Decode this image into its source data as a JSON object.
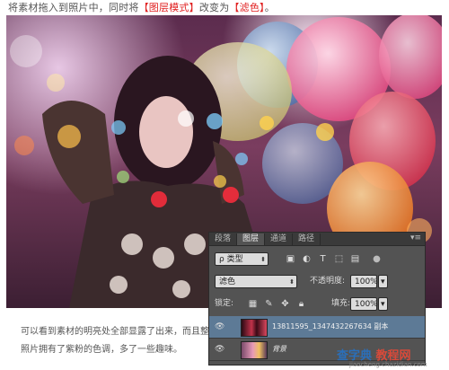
{
  "intro": {
    "text_before": "将素材拖入到照片中，同时将",
    "highlight_1": "【图层模式】",
    "text_middle": "改变为",
    "highlight_2": "【滤色】",
    "text_end": "。"
  },
  "caption": {
    "text": "可以看到素材的明亮处全部显露了出来，而且整个照片拥有了紫粉的色调，多了一些趣味。"
  },
  "layers_panel": {
    "tabs": [
      "段落",
      "图层",
      "通道",
      "路径"
    ],
    "active_tab": "图层",
    "filter_label": "ρ 类型",
    "blend_mode": "滤色",
    "opacity_label": "不透明度:",
    "opacity_value": "100%",
    "lock_label": "锁定:",
    "fill_label": "填充:",
    "fill_value": "100%",
    "layers": [
      {
        "name": "13811595_1347432267634 副本",
        "active": true
      },
      {
        "name": "背景",
        "active": false
      }
    ]
  },
  "watermark": {
    "main": "查字典",
    "sub": "教程网",
    "url": "jiaocheng.chazidian.com"
  },
  "colors": {
    "highlight": "#e02020",
    "panel_bg": "#535353",
    "active_layer": "#5d7a96"
  }
}
